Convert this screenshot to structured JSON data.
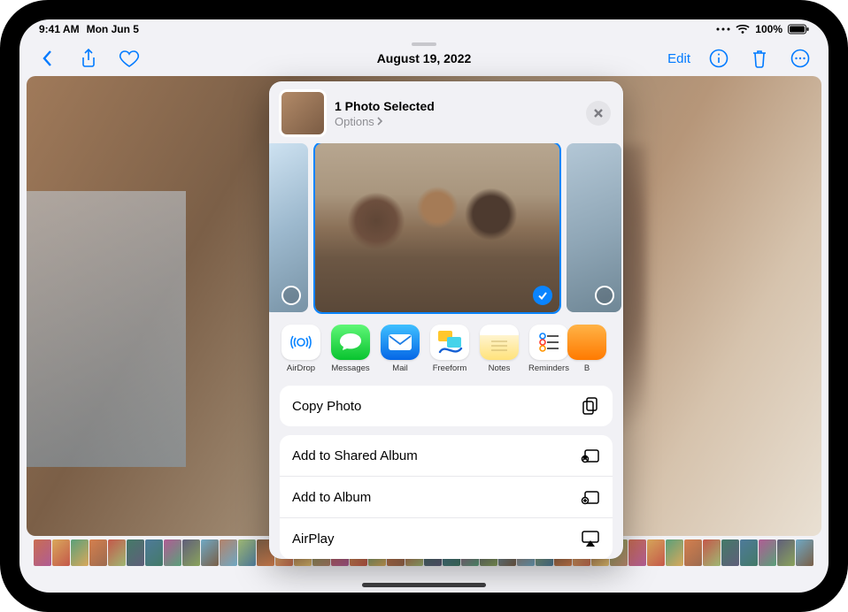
{
  "status": {
    "time": "9:41 AM",
    "date": "Mon Jun 5",
    "battery_pct": "100%"
  },
  "toolbar": {
    "title": "August 19, 2022",
    "edit_label": "Edit"
  },
  "share_sheet": {
    "title": "1 Photo Selected",
    "options_label": "Options",
    "apps": [
      {
        "name": "AirDrop"
      },
      {
        "name": "Messages"
      },
      {
        "name": "Mail"
      },
      {
        "name": "Freeform"
      },
      {
        "name": "Notes"
      },
      {
        "name": "Reminders"
      },
      {
        "name": "B"
      }
    ],
    "actions_primary": [
      {
        "label": "Copy Photo",
        "icon": "copy"
      }
    ],
    "actions_secondary": [
      {
        "label": "Add to Shared Album",
        "icon": "shared-album"
      },
      {
        "label": "Add to Album",
        "icon": "album"
      },
      {
        "label": "AirPlay",
        "icon": "airplay"
      }
    ]
  }
}
